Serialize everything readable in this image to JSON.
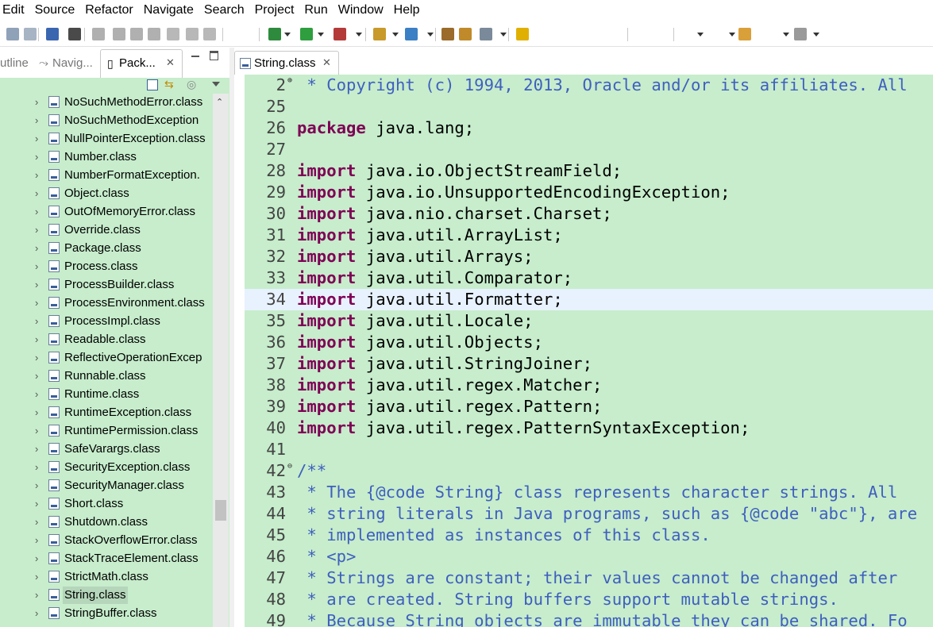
{
  "menubar": {
    "items": [
      "Edit",
      "Source",
      "Refactor",
      "Navigate",
      "Search",
      "Project",
      "Run",
      "Window",
      "Help"
    ]
  },
  "toolbar": {
    "icons": [
      "save-icon",
      "save-all-icon",
      "terminal-icon",
      "skip-breakpoints-icon",
      "resume-icon",
      "suspend-icon",
      "terminate-icon",
      "disconnect-icon",
      "step-into-icon",
      "step-over-icon",
      "step-return-icon",
      "debug-icon",
      "run-icon",
      "run-last-icon",
      "new-java-project-icon",
      "new-class-icon",
      "open-type-icon",
      "open-task-icon",
      "search-icon",
      "toggle-mark-occurrences-icon",
      "back-icon",
      "forward-icon"
    ]
  },
  "left_panel": {
    "tabs": {
      "outline": "utline",
      "navigator": "Navig...",
      "package_explorer": "Pack..."
    },
    "tree_items": [
      "NoSuchMethodError.class",
      "NoSuchMethodException",
      "NullPointerException.class",
      "Number.class",
      "NumberFormatException.",
      "Object.class",
      "OutOfMemoryError.class",
      "Override.class",
      "Package.class",
      "Process.class",
      "ProcessBuilder.class",
      "ProcessEnvironment.class",
      "ProcessImpl.class",
      "Readable.class",
      "ReflectiveOperationExcep",
      "Runnable.class",
      "Runtime.class",
      "RuntimeException.class",
      "RuntimePermission.class",
      "SafeVarargs.class",
      "SecurityException.class",
      "SecurityManager.class",
      "Short.class",
      "Shutdown.class",
      "StackOverflowError.class",
      "StackTraceElement.class",
      "StrictMath.class",
      "String.class",
      "StringBuffer.class"
    ],
    "selected_item": "String.class"
  },
  "editor": {
    "tab_label": "String.class",
    "current_line": "34",
    "lines": [
      {
        "n": "2",
        "t": " * Copyright (c) 1994, 2013, Oracle and/or its affiliates. All"
      },
      {
        "n": "25",
        "t": ""
      },
      {
        "n": "26",
        "t": "package java.lang;"
      },
      {
        "n": "27",
        "t": ""
      },
      {
        "n": "28",
        "t": "import java.io.ObjectStreamField;"
      },
      {
        "n": "29",
        "t": "import java.io.UnsupportedEncodingException;"
      },
      {
        "n": "30",
        "t": "import java.nio.charset.Charset;"
      },
      {
        "n": "31",
        "t": "import java.util.ArrayList;"
      },
      {
        "n": "32",
        "t": "import java.util.Arrays;"
      },
      {
        "n": "33",
        "t": "import java.util.Comparator;"
      },
      {
        "n": "34",
        "t": "import java.util.Formatter;"
      },
      {
        "n": "35",
        "t": "import java.util.Locale;"
      },
      {
        "n": "36",
        "t": "import java.util.Objects;"
      },
      {
        "n": "37",
        "t": "import java.util.StringJoiner;"
      },
      {
        "n": "38",
        "t": "import java.util.regex.Matcher;"
      },
      {
        "n": "39",
        "t": "import java.util.regex.Pattern;"
      },
      {
        "n": "40",
        "t": "import java.util.regex.PatternSyntaxException;"
      },
      {
        "n": "41",
        "t": ""
      },
      {
        "n": "42",
        "t": "/**"
      },
      {
        "n": "43",
        "t": " * The {@code String} class represents character strings. All"
      },
      {
        "n": "44",
        "t": " * string literals in Java programs, such as {@code \"abc\"}, are"
      },
      {
        "n": "45",
        "t": " * implemented as instances of this class."
      },
      {
        "n": "46",
        "t": " * <p>"
      },
      {
        "n": "47",
        "t": " * Strings are constant; their values cannot be changed after"
      },
      {
        "n": "48",
        "t": " * are created. String buffers support mutable strings."
      },
      {
        "n": "49",
        "t": " * Because String objects are immutable they can be shared. Fo"
      }
    ]
  },
  "colors": {
    "editor_background": "#c7edcc",
    "keyword": "#7f0055",
    "comment": "#3f5fbf",
    "current_line_highlight": "#e8f2fe"
  }
}
